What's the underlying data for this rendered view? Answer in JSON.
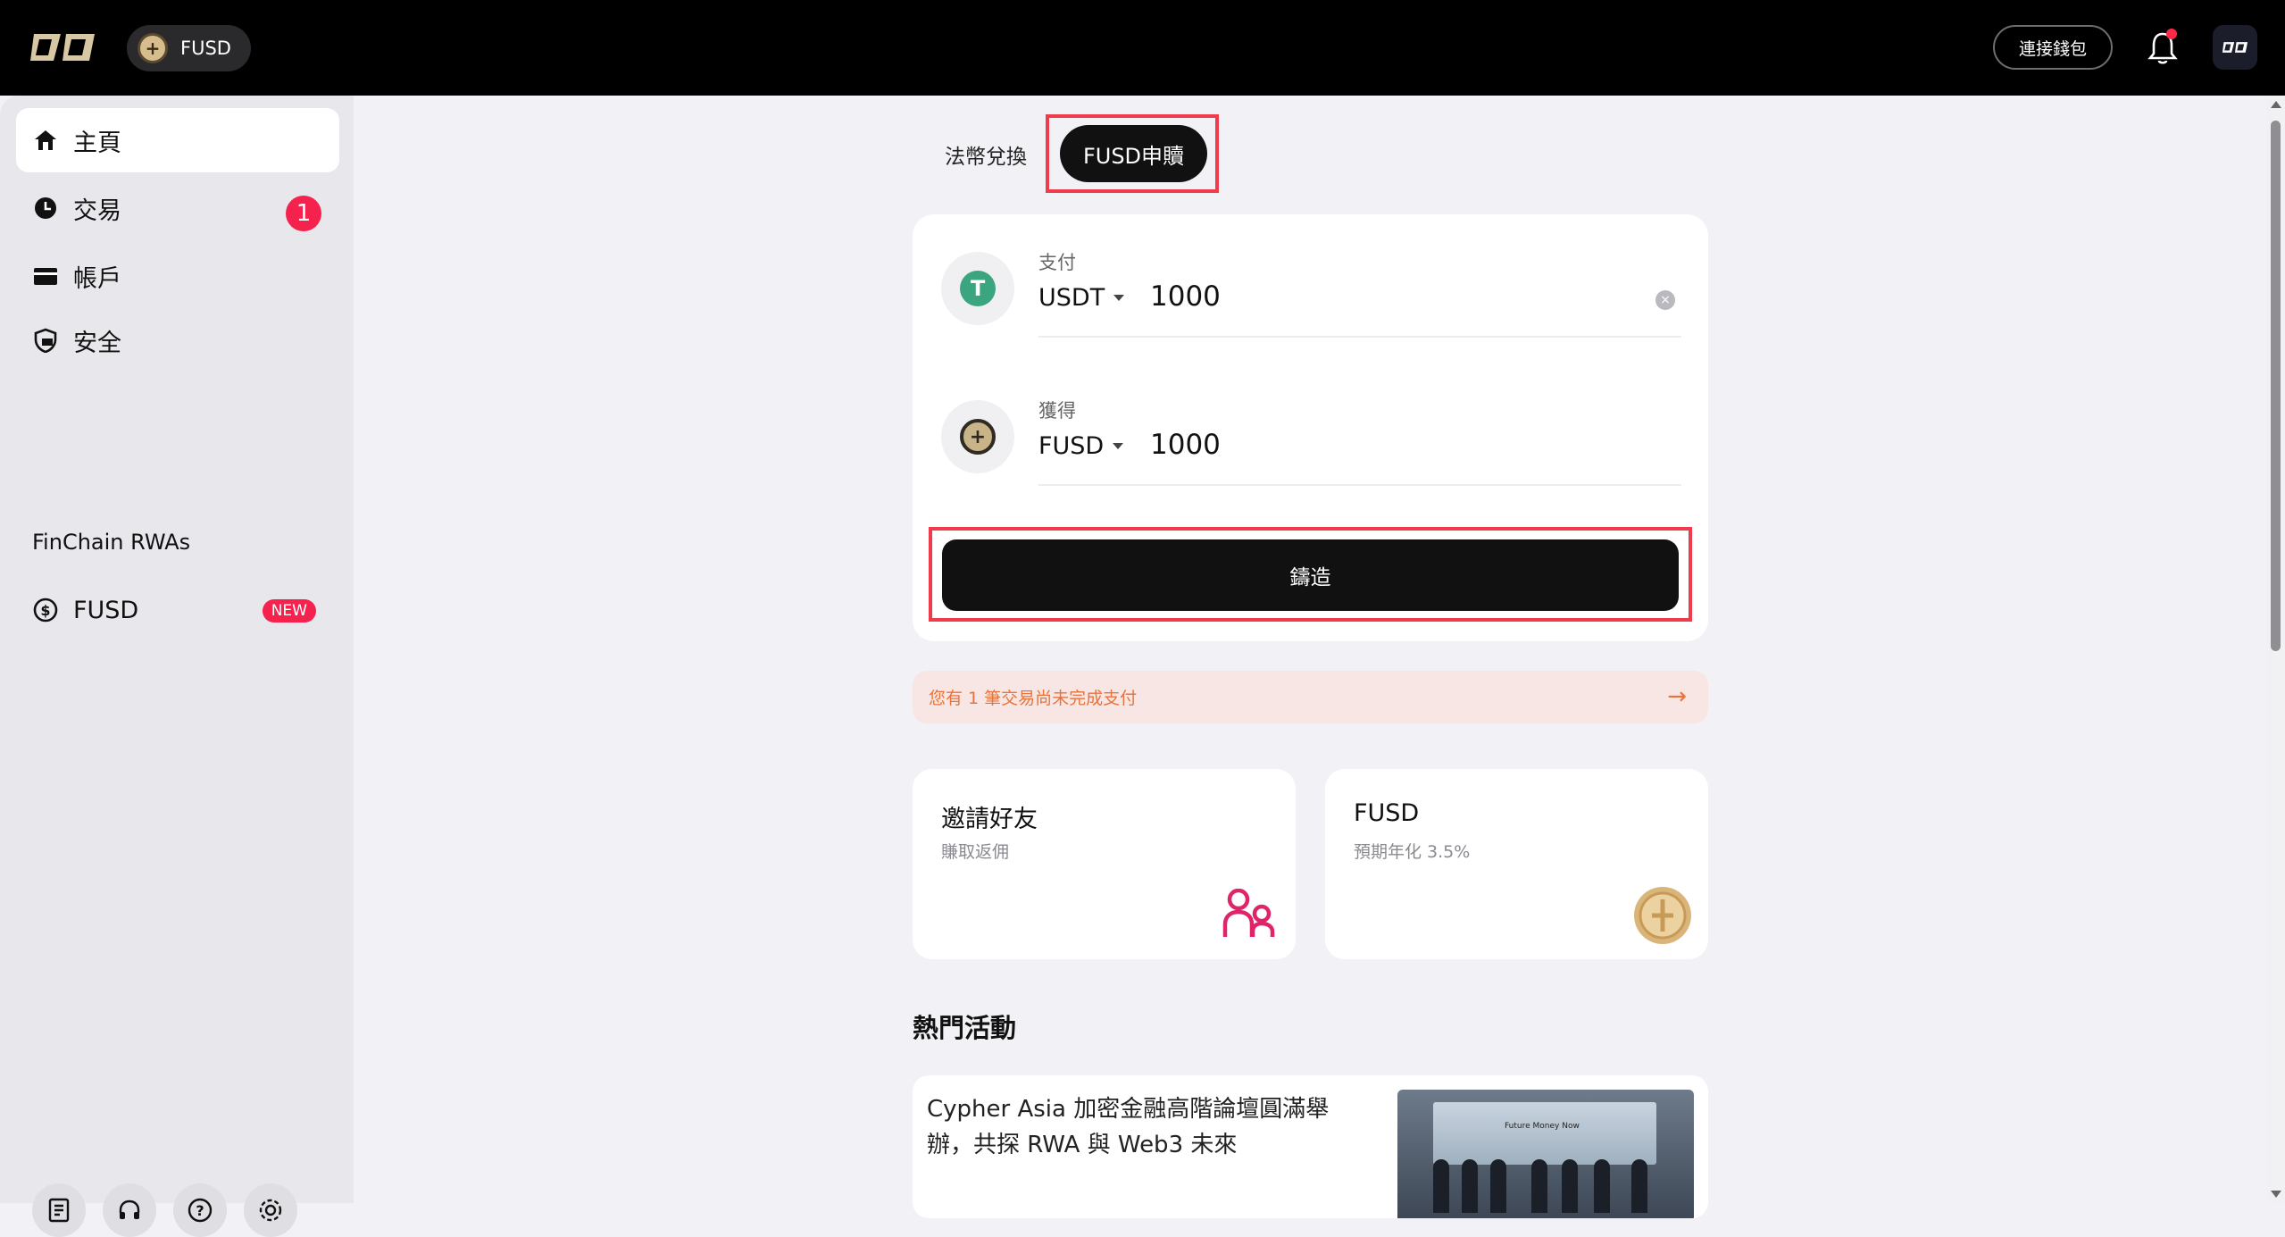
{
  "header": {
    "token_symbol": "FUSD",
    "connect_wallet_label": "連接錢包"
  },
  "sidebar": {
    "items": [
      {
        "label": "主頁",
        "icon": "home-icon"
      },
      {
        "label": "交易",
        "icon": "clock-icon",
        "badge": "1"
      },
      {
        "label": "帳戶",
        "icon": "card-icon"
      },
      {
        "label": "安全",
        "icon": "shield-icon"
      }
    ],
    "section_label": "FinChain RWAs",
    "fusd_item": {
      "label": "FUSD",
      "badge": "NEW"
    },
    "footer_icons": [
      "document-icon",
      "headset-icon",
      "help-icon",
      "settings-icon"
    ]
  },
  "tabs": {
    "fiat_label": "法幣兌換",
    "fusd_label": "FUSD申贖"
  },
  "swap": {
    "pay_label": "支付",
    "pay_currency": "USDT",
    "pay_amount": "1000",
    "receive_label": "獲得",
    "receive_currency": "FUSD",
    "receive_amount": "1000",
    "mint_label": "鑄造"
  },
  "alert": {
    "text": "您有 1 筆交易尚未完成支付"
  },
  "cards": {
    "invite_title": "邀請好友",
    "invite_sub": "賺取返佣",
    "fusd_title": "FUSD",
    "fusd_sub": "預期年化 3.5%"
  },
  "hot": {
    "title": "熱門活動",
    "news_text": "Cypher Asia 加密金融高階論壇圓滿舉辦，共探 RWA 與 Web3 未來",
    "news_image_caption": "Future Money Now"
  },
  "colors": {
    "accent_red": "#f5224d",
    "highlight_border": "#ef3b4b",
    "alert_text": "#e8733c",
    "usdt_green": "#3aa57e",
    "invite_pink": "#e0246a"
  }
}
